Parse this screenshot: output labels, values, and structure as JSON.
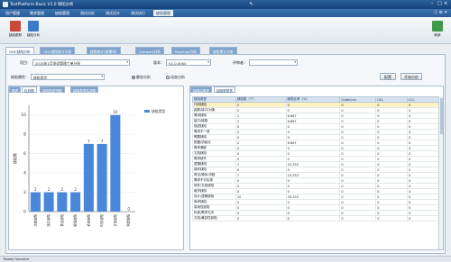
{
  "window": {
    "title": "TestPlatform Basic V1.0   缺陷分析"
  },
  "menubar": {
    "tabs": [
      {
        "label": "用户管理"
      },
      {
        "label": "需求管理"
      },
      {
        "label": "缺陷管理"
      },
      {
        "label": "测试分析"
      },
      {
        "label": "测试设计"
      },
      {
        "label": "测试执行"
      },
      {
        "label": "缺陷管理"
      }
    ],
    "active_index": 6,
    "right_icons": "ⓘ  ⚙  ✕"
  },
  "toolbar": {
    "buttons": [
      {
        "label": "缺陷跟踪",
        "color": "#c94a3a"
      },
      {
        "label": "缺陷分析",
        "color": "#3a7ac9"
      }
    ],
    "right_button": {
      "label": "刷新",
      "color": "#3f9a4a"
    }
  },
  "subtabs": [
    {
      "label": "ODC缺陷分析"
    },
    {
      "label": "ODC缺陷统计分析"
    },
    {
      "label": "缺陷统计(按模块)"
    },
    {
      "label": "Compert分析"
    },
    {
      "label": "Rayleigh分析"
    },
    {
      "label": "缺陷累计分析"
    }
  ],
  "filters": {
    "project_label": "项目：",
    "project_value": "2015年1月测试管理工单分析",
    "version_label": "版本：",
    "version_value": "V1.0.0000",
    "submitter_label": "评审者：",
    "submitter_value": "",
    "attr_label": "缺陷属性：",
    "attr_value": "缺陷类型",
    "radio_static": "静态分析",
    "radio_dynamic": "动态分析",
    "config_button": "配置",
    "start_button": "开始分析"
  },
  "left_tabs": [
    {
      "label": "图表"
    },
    {
      "label": "柱状图"
    },
    {
      "label": "缺陷类型饼图"
    },
    {
      "label": "缺陷类型柱状图"
    }
  ],
  "chart_data": {
    "type": "bar",
    "legend": "缺陷类型",
    "ylabel": "缺陷数",
    "ylim": [
      0,
      11
    ],
    "yticks": [
      0,
      2,
      4,
      6,
      8,
      10
    ],
    "categories": [
      "功能缺陷",
      "接口缺陷",
      "算法缺陷",
      "赋值缺陷",
      "检查缺陷",
      "时序缺陷",
      "文档缺陷",
      "构建缺陷"
    ],
    "values": [
      2,
      2,
      2,
      2,
      7,
      7,
      10,
      0
    ],
    "bar_color": "#4a86d9"
  },
  "right_tabs": [
    {
      "label": "缺陷结果表"
    },
    {
      "label": "缺陷类型表"
    }
  ],
  "table": {
    "headers": [
      "缺陷类型",
      "缺陷数（个）",
      "缺陷比率（%）",
      "SuiteLine",
      "UCL",
      "LCL"
    ],
    "rows": [
      [
        "代码缺陷",
        "",
        "",
        "",
        "",
        ""
      ],
      [
        "函数/接口/对象",
        "2",
        "",
        "",
        "",
        ""
      ],
      [
        "需求缺陷",
        "2",
        "6.667",
        "",
        "",
        ""
      ],
      [
        "接口/链路",
        "2",
        "6.667",
        "",
        "",
        ""
      ],
      [
        "描述缺陷",
        "0",
        "",
        "",
        "",
        ""
      ],
      [
        "需求不一致",
        "0",
        "",
        "",
        "",
        ""
      ],
      [
        "需要缺陷",
        "0",
        "",
        "",
        "",
        ""
      ],
      [
        "配置/初始化",
        "2",
        "6.667",
        "",
        "",
        ""
      ],
      [
        "需求漏缺",
        "0",
        "",
        "",
        "",
        ""
      ],
      [
        "文档缺陷",
        "0",
        "",
        "",
        "",
        ""
      ],
      [
        "需求缺失",
        "0",
        "",
        "",
        "",
        ""
      ],
      [
        "逻辑缺陷",
        "7",
        "23.333",
        "",
        "",
        ""
      ],
      [
        "操作缺陷",
        "0",
        "",
        "",
        "",
        ""
      ],
      [
        "算法/顺序/流程",
        "7",
        "23.333",
        "",
        "",
        ""
      ],
      [
        "需求不可实现",
        "0",
        "",
        "",
        "",
        ""
      ],
      [
        "软件/文档缺陷",
        "0",
        "",
        "",
        "",
        ""
      ],
      [
        "维护缺陷",
        "0",
        "",
        "",
        "",
        ""
      ],
      [
        "设计/逻辑缺陷",
        "10",
        "33.333",
        "",
        "",
        ""
      ],
      [
        "参考缺陷",
        "0",
        "",
        "",
        "",
        ""
      ],
      [
        "易用性缺陷",
        "0",
        "",
        "",
        "",
        ""
      ],
      [
        "标准/需求无关",
        "0",
        "",
        "",
        "",
        ""
      ],
      [
        "文档/兼容性缺陷",
        "0",
        "",
        "",
        "",
        ""
      ]
    ],
    "row_fill": "0",
    "highlight_row": 0
  },
  "statusbar": {
    "text": "Ready Operator"
  }
}
